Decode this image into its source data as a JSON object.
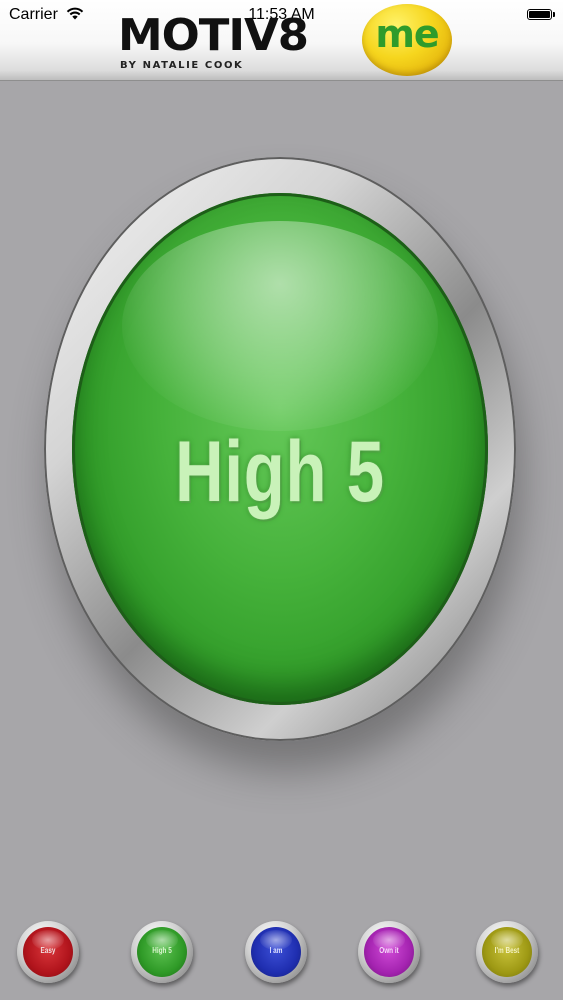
{
  "status_bar": {
    "carrier": "Carrier",
    "time": "11:53 AM",
    "icons": [
      "wifi-icon",
      "battery-icon"
    ]
  },
  "header": {
    "logo_word": "MOTIV8",
    "logo_badge": "me",
    "logo_subtitle": "BY NATALIE COOK",
    "colors": {
      "badge_yellow": "#f6d61e",
      "badge_text_green": "#2f9b2b"
    }
  },
  "main_button": {
    "label": "High 5",
    "color": "#46b23b"
  },
  "bottom_buttons": [
    {
      "label": "Easy",
      "color": "#b1141c"
    },
    {
      "label": "High 5",
      "color": "#2f9a27"
    },
    {
      "label": "I am",
      "color": "#1f2eb0"
    },
    {
      "label": "Own it",
      "color": "#a423b0"
    },
    {
      "label": "I'm Best",
      "color": "#9e9914"
    }
  ],
  "background_color": "#a7a6a9"
}
